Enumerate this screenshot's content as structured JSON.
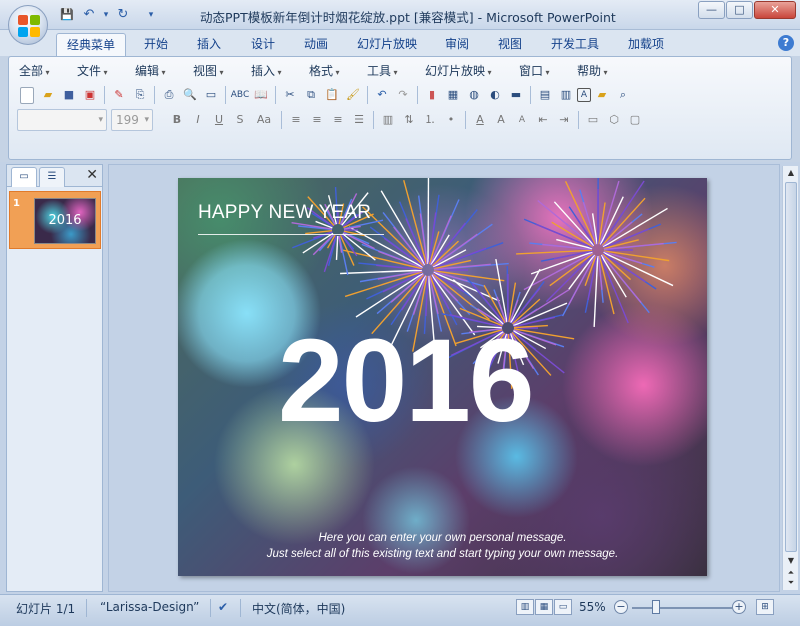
{
  "window": {
    "title": "动态PPT模板新年倒计时烟花绽放.ppt [兼容模式] - Microsoft PowerPoint",
    "controls": [
      "—",
      "□",
      "✕"
    ]
  },
  "qat": {
    "save": "💾",
    "undo": "↶",
    "redo": "↻",
    "more": "▾"
  },
  "tabs": [
    "经典菜单",
    "开始",
    "插入",
    "设计",
    "动画",
    "幻灯片放映",
    "审阅",
    "视图",
    "开发工具",
    "加载项"
  ],
  "help": "?",
  "menus": [
    "全部",
    "文件",
    "编辑",
    "视图",
    "插入",
    "格式",
    "工具",
    "幻灯片放映",
    "窗口",
    "帮助"
  ],
  "font_name": "",
  "font_size": "199",
  "format_buttons": {
    "bold": "B",
    "italic": "I",
    "underline": "U",
    "shadow": "S",
    "case": "Aa"
  },
  "panel": {
    "slide_number": "1",
    "thumb_text": "2016",
    "close": "✕"
  },
  "slide": {
    "title": "HAPPY NEW YEAR",
    "year": "2016",
    "message_line1": "Here you can enter your own personal message.",
    "message_line2": "Just select all of this existing text and start typing your own message."
  },
  "status": {
    "slide_info": "幻灯片 1/1",
    "theme": "“Larissa-Design”",
    "language": "中文(简体，中国)",
    "zoom": "55%"
  },
  "colors": {
    "accent": "#15428b",
    "thumb_selected": "#f1a055"
  }
}
